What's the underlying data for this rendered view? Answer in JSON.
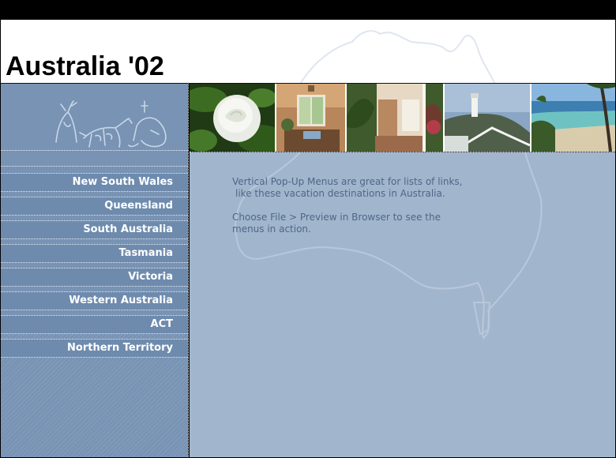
{
  "header": {
    "title": "Australia '02"
  },
  "sidebar": {
    "rock_art_icon": "rock-art-figures-icon",
    "items": [
      {
        "label": "New South Wales"
      },
      {
        "label": "Queensland"
      },
      {
        "label": "South Australia"
      },
      {
        "label": "Tasmania"
      },
      {
        "label": "Victoria"
      },
      {
        "label": "Western Australia"
      },
      {
        "label": "ACT"
      },
      {
        "label": "Northern Territory"
      }
    ]
  },
  "photos": [
    {
      "subject": "white rose"
    },
    {
      "subject": "sunlit interior room"
    },
    {
      "subject": "veranda with tropical plants"
    },
    {
      "subject": "lighthouse on cliff"
    },
    {
      "subject": "beach with palm trees"
    }
  ],
  "main": {
    "intro_line1": "Vertical Pop-Up Menus are great for lists of links,",
    "intro_line2": "like these vacation destinations in Australia.",
    "instructions_line1": "Choose File > Preview in Browser to see the",
    "instructions_line2": "menus in action."
  },
  "colors": {
    "sidebar": "#7893b4",
    "content": "#a1b5cd",
    "body_text": "#4e6787",
    "nav_text": "#ffffff"
  }
}
